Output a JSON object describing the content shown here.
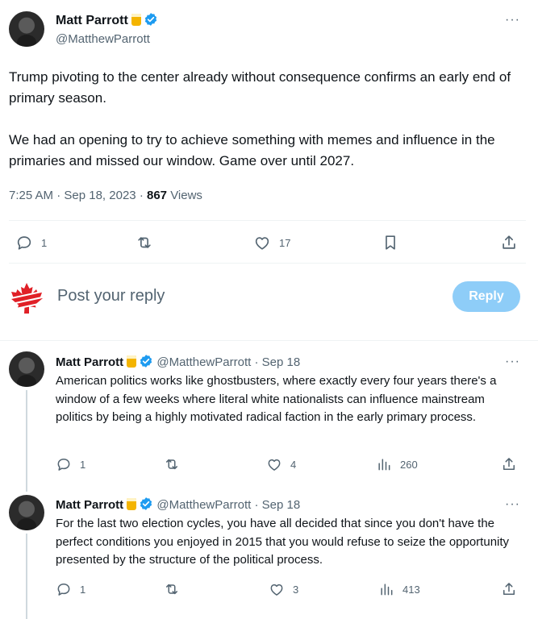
{
  "main_tweet": {
    "author_name": "Matt Parrott",
    "author_handle": "@MatthewParrott",
    "paragraphs": [
      "Trump pivoting to the center already without consequence confirms an early end of primary season.",
      "We had an opening to try to achieve something with memes and influence in the primaries and missed our window. Game over until 2027."
    ],
    "time": "7:25 AM",
    "date": "Sep 18, 2023",
    "views_count": "867",
    "views_label": "Views",
    "replies": "1",
    "likes": "17",
    "more": "···"
  },
  "reply_box": {
    "placeholder": "Post your reply",
    "button_label": "Reply"
  },
  "replies": [
    {
      "author_name": "Matt Parrott",
      "author_handle": "@MatthewParrott",
      "date": "Sep 18",
      "text": "American politics works like ghostbusters, where exactly every four years there's a window of a few weeks where literal white nationalists can influence mainstream politics by being a highly motivated radical faction in the early primary process.",
      "replies": "1",
      "likes": "4",
      "views": "260",
      "more": "···"
    },
    {
      "author_name": "Matt Parrott",
      "author_handle": "@MatthewParrott",
      "date": "Sep 18",
      "text": "For the last two election cycles, you have all decided that since you don't have the perfect conditions you enjoyed in 2015 that you would refuse to seize the opportunity presented by the structure of the political process.",
      "replies": "1",
      "likes": "3",
      "views": "413",
      "more": "···"
    }
  ],
  "colors": {
    "verified": "#1d9bf0",
    "muted": "#536471",
    "reply_button": "#8ecdf8",
    "divider": "#eff3f4",
    "maple_leaf": "#e02027"
  }
}
